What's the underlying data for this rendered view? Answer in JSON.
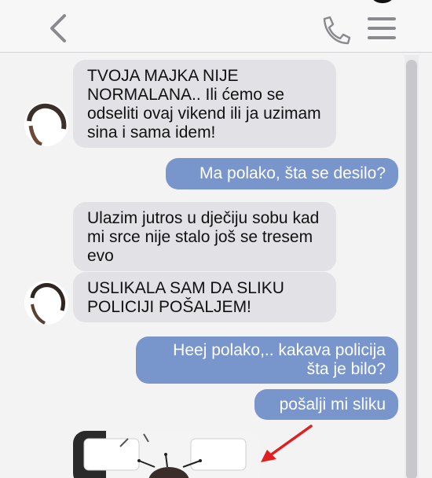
{
  "header": {
    "back_icon": "chevron-left-icon",
    "call_icon": "phone-icon",
    "menu_icon": "hamburger-menu-icon"
  },
  "colors": {
    "outgoing_bubble": "#7895cc",
    "incoming_bubble": "#e1e1e6",
    "annotation_arrow": "#e02020"
  },
  "messages": [
    {
      "side": "incoming",
      "text": "TVOJA MAJKA NIJE NORMALANA.. Ili ćemo se odseliti ovaj vikend ili ja uzimam sina i sama idem!"
    },
    {
      "side": "outgoing",
      "text": "Ma polako, šta se desilo?"
    },
    {
      "side": "incoming",
      "text": "Ulazim jutros u dječiju sobu kad mi srce nije stalo još se tresem evo"
    },
    {
      "side": "incoming",
      "text": "USLIKALA SAM DA SLIKU POLICIJI POŠALJEM!"
    },
    {
      "side": "outgoing",
      "text": "Heej polako,.. kakava policija šta je bilo?"
    },
    {
      "side": "outgoing",
      "text": "pošalji mi sliku"
    },
    {
      "side": "incoming",
      "type": "photo",
      "text": ""
    }
  ]
}
